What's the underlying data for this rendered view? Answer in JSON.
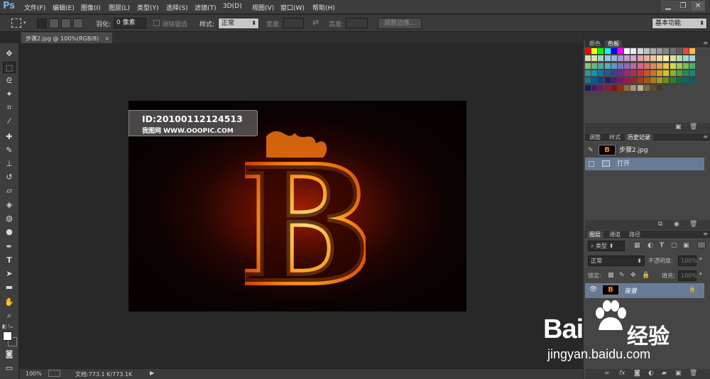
{
  "app": {
    "logo": "Ps"
  },
  "menus": [
    "文件(F)",
    "编辑(E)",
    "图像(I)",
    "图层(L)",
    "类型(Y)",
    "选择(S)",
    "滤镜(T)",
    "3D(D)",
    "视图(V)",
    "窗口(W)",
    "帮助(H)"
  ],
  "window_controls": [
    "minimize-icon",
    "restore-icon",
    "close-icon"
  ],
  "options": {
    "feather_label": "羽化:",
    "feather_value": "0 像素",
    "antialias_label": "消除锯齿",
    "style_label": "样式:",
    "style_value": "正常",
    "width_label": "宽度:",
    "height_label": "高度:",
    "refine_button": "调整边缘...",
    "workspace": "基本功能"
  },
  "tools": [
    "move-tool-icon",
    "marquee-tool-icon",
    "lasso-tool-icon",
    "quick-select-tool-icon",
    "crop-tool-icon",
    "eyedropper-tool-icon",
    "healing-brush-tool-icon",
    "brush-tool-icon",
    "clone-stamp-tool-icon",
    "history-brush-tool-icon",
    "eraser-tool-icon",
    "paint-bucket-tool-icon",
    "blur-tool-icon",
    "dodge-tool-icon",
    "pen-tool-icon",
    "type-tool-icon",
    "path-selection-tool-icon",
    "rectangle-tool-icon",
    "hand-tool-icon",
    "zoom-tool-icon",
    "default-colors-icon",
    "foreground-color-swatch",
    "quick-mask-icon",
    "screen-mode-icon"
  ],
  "document": {
    "tab_title": "步骤2.jpg @ 100%(RGB/8)",
    "zoom": "100%",
    "doc_info": "文档:773.1 K/773.1K",
    "watermark_id": "ID:20100112124513",
    "watermark_site": "我图网 WWW.OOOPIC.COM",
    "letter": "B"
  },
  "swatch_panel": {
    "tabs": [
      "颜色",
      "色板"
    ],
    "active": "色板"
  },
  "history_panel": {
    "tabs": [
      "调整",
      "样式",
      "历史记录"
    ],
    "active": "历史记录",
    "snapshot": "步骤2.jpg",
    "items": [
      "打开"
    ]
  },
  "layers_panel": {
    "tabs": [
      "图层",
      "通道",
      "路径"
    ],
    "active": "图层",
    "filter_kind": "类型",
    "blend_mode": "正常",
    "opacity_label": "不透明度:",
    "opacity_value": "100%",
    "lock_label": "锁定:",
    "fill_label": "填充:",
    "fill_value": "100%",
    "layers": [
      {
        "name": "背景",
        "thumb": "B"
      }
    ]
  },
  "overlay": {
    "brand": "Bai",
    "brand2": "经验",
    "url": "jingyan.baidu.com"
  },
  "colors": {
    "accent": "#6fb2e6",
    "selected_row": "#687b96",
    "panel_bg": "#454545",
    "canvas_bg": "#282828",
    "fire": "#ff8a1e"
  },
  "swatch_colors": [
    "#ff0000",
    "#ffff00",
    "#00ff00",
    "#00ffff",
    "#0000ff",
    "#ff00ff",
    "#ffffff",
    "#ebebeb",
    "#d6d6d6",
    "#c2c2c2",
    "#adadad",
    "#999999",
    "#858585",
    "#707070",
    "#5c5c5c",
    "#ff3f3f",
    "#ffbf3f",
    "#cfe0a8",
    "#d5e8b0",
    "#a2d5bf",
    "#97c9e6",
    "#9db4de",
    "#a59bcf",
    "#c69bcf",
    "#e2a0c6",
    "#e2a0a4",
    "#e4b39d",
    "#e9c79d",
    "#f2e09d",
    "#fbf29d",
    "#d0e6a1",
    "#b6dca5",
    "#a5d9c9",
    "#9fd6e6",
    "#8ac07a",
    "#6bb286",
    "#4eaa92",
    "#52aebb",
    "#5c96c8",
    "#6e78b9",
    "#8c6ab0",
    "#b36aac",
    "#d16a8c",
    "#d87168",
    "#dd8a5a",
    "#e3a54f",
    "#ecc648",
    "#d9d84a",
    "#a8c84c",
    "#77bb55",
    "#4fae6b",
    "#2c9a8f",
    "#1b91a6",
    "#1774ad",
    "#2159a0",
    "#3f3d8c",
    "#6a2f86",
    "#952a7b",
    "#c0265d",
    "#c5373a",
    "#c8562c",
    "#cf7624",
    "#d7a01f",
    "#cfc322",
    "#92b02a",
    "#4fa23a",
    "#1f9153",
    "#128a7e",
    "#0d7a89",
    "#0a5e8b",
    "#0b4481",
    "#211f6f",
    "#4d1c6c",
    "#731a64",
    "#9a174c",
    "#a0212a",
    "#a33a1d",
    "#a65619",
    "#ad7d15",
    "#a59a18",
    "#70891f",
    "#337e2a",
    "#11703f",
    "#0a6760",
    "#0a5a67",
    "#1a1a6a",
    "#4a1a6a",
    "#701a5a",
    "#921640",
    "#7a1818",
    "#8a3014",
    "#916c42",
    "#a89572",
    "#bfb18f",
    "#7a6a4a",
    "#5c4c2c",
    "#4a3a1e"
  ]
}
